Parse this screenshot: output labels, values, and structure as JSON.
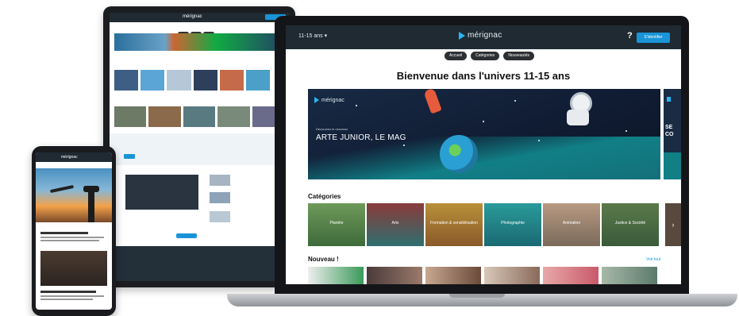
{
  "laptop": {
    "topbar": {
      "age_select": "11-15 ans",
      "brand": "mérignac",
      "help": "?",
      "connect": "S'identifier"
    },
    "nav_pills": [
      "Accueil",
      "Catégories",
      "Nouveautés"
    ],
    "welcome": "Bienvenue dans l'univers 11-15 ans",
    "hero": {
      "logo": "mérignac",
      "kicker": "Découvrez le nouveau",
      "title": "ARTE JUNIOR, LE MAG"
    },
    "hero_next": {
      "text": "SE\nCO"
    },
    "categories_title": "Catégories",
    "categories": [
      {
        "label": "Planète"
      },
      {
        "label": "Arts"
      },
      {
        "label": "Formation & sensibilisation"
      },
      {
        "label": "Photographie"
      },
      {
        "label": "Animation"
      },
      {
        "label": "Justice & Société"
      }
    ],
    "categories_next": "›",
    "news_title": "Nouveau !",
    "news_more": "Voir tout",
    "colors": {
      "accent": "#1a94d6",
      "topbar": "#1f2a33"
    }
  },
  "tablet": {
    "brand": "mérignac"
  },
  "phone": {
    "brand": "mérignac"
  }
}
